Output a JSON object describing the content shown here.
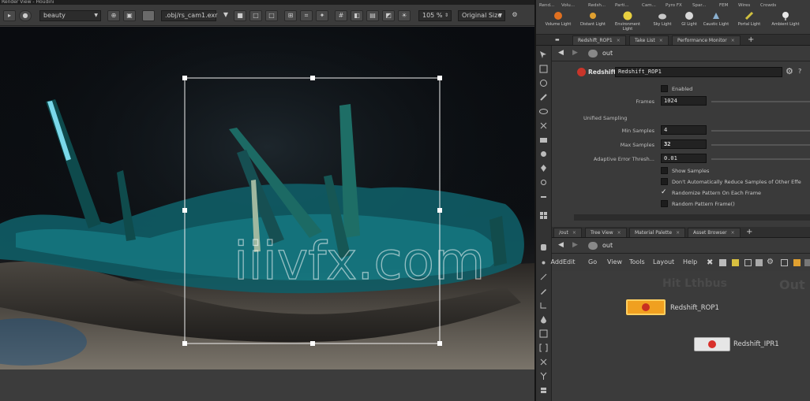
{
  "window": {
    "title_fragment": "Render View - Houdini"
  },
  "viewer_toolbar": {
    "display_option": "beauty",
    "file_path": ".obj/rs_cam1.exr",
    "zoom": "105 %",
    "fit_mode": "Original Size"
  },
  "watermark": "iiivfx.com",
  "shelf": {
    "tabs": [
      "Rend...",
      "Volu...",
      "Redsh...",
      "Parti...",
      "Cam...",
      "Pyro FX",
      "Spar...",
      "FEM",
      "Wires",
      "Crowds"
    ],
    "tools": [
      {
        "label": "Volume Light",
        "icon": "volume-light-icon",
        "color": "#e07020"
      },
      {
        "label": "Distant Light",
        "icon": "distant-light-icon",
        "color": "#e0a030"
      },
      {
        "label": "Environment Light",
        "icon": "environment-light-icon",
        "color": "#e8d040"
      },
      {
        "label": "Sky Light",
        "icon": "sky-light-icon",
        "color": "#c8c8c8"
      },
      {
        "label": "GI Light",
        "icon": "gi-light-icon",
        "color": "#d8d8d8"
      },
      {
        "label": "Caustic Light",
        "icon": "caustic-light-icon",
        "color": "#8ab0d0"
      },
      {
        "label": "Portal Light",
        "icon": "portal-light-icon",
        "color": "#d0c040"
      },
      {
        "label": "Ambient Light",
        "icon": "ambient-light-icon",
        "color": "#e8e8e8"
      }
    ]
  },
  "param_pane": {
    "tabs": [
      "Redshift_ROP1",
      "Take List",
      "Performance Monitor"
    ],
    "path": "out",
    "node_type": "Redshift",
    "node_name": "Redshift_ROP1",
    "enabled_label": "Enabled",
    "frames_label": "Frames",
    "frames_value": "1024",
    "section": "Unified Sampling",
    "min_samples_label": "Min Samples",
    "min_samples_value": "4",
    "max_samples_label": "Max Samples",
    "max_samples_value": "32",
    "adaptive_label": "Adaptive Error Thresh...",
    "adaptive_value": "0.01",
    "checkboxes": [
      {
        "label": "Show Samples",
        "checked": false
      },
      {
        "label": "Don't Automatically Reduce Samples of Other Effe",
        "checked": false
      },
      {
        "label": "Randomize Pattern On Each Frame",
        "checked": true
      },
      {
        "label": "Random Pattern Frame()",
        "checked": false
      }
    ]
  },
  "network_pane": {
    "tabs": [
      "/out",
      "Tree View",
      "Material Palette",
      "Asset Browser"
    ],
    "path": "out",
    "menu": [
      "Add",
      "Edit",
      "Go",
      "View",
      "Tools",
      "Layout",
      "Help"
    ],
    "context_label_left": "Hit Lthbus",
    "context_label_right": "Out",
    "nodes": [
      {
        "name": "Redshift_ROP1"
      },
      {
        "name": "Redshift_IPR1"
      }
    ]
  }
}
